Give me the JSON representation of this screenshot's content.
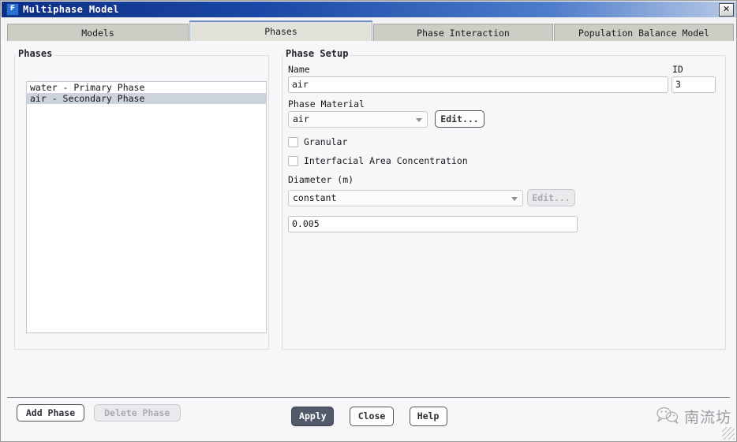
{
  "window": {
    "title": "Multiphase Model",
    "icon": "fluent-app-icon",
    "icon_letter": "F",
    "close_label": "✕"
  },
  "tabs": [
    {
      "label": "Models",
      "selected": false
    },
    {
      "label": "Phases",
      "selected": true
    },
    {
      "label": "Phase Interaction",
      "selected": false
    },
    {
      "label": "Population Balance Model",
      "selected": false
    }
  ],
  "phases_panel": {
    "title": "Phases",
    "items": [
      {
        "label": "water - Primary Phase",
        "selected": false
      },
      {
        "label": "air - Secondary Phase",
        "selected": true
      }
    ],
    "add_label": "Add Phase",
    "delete_label": "Delete Phase",
    "delete_enabled": false
  },
  "phase_setup": {
    "title": "Phase Setup",
    "name_label": "Name",
    "name_value": "air",
    "id_label": "ID",
    "id_value": "3",
    "material_label": "Phase Material",
    "material_value": "air",
    "material_edit_label": "Edit...",
    "granular_label": "Granular",
    "granular_checked": false,
    "interfacial_label": "Interfacial Area Concentration",
    "interfacial_checked": false,
    "diameter_label": "Diameter (m)",
    "diameter_method": "constant",
    "diameter_edit_label": "Edit...",
    "diameter_edit_enabled": false,
    "diameter_value": "0.005"
  },
  "footer": {
    "apply_label": "Apply",
    "close_label": "Close",
    "help_label": "Help"
  },
  "watermark": {
    "text": "南流坊",
    "icon": "wechat-icon"
  },
  "colors": {
    "titlebar_start": "#0c2f84",
    "tab_selected": "#e2e1da",
    "tab_normal": "#cdccc5",
    "list_selection": "#ccd3dc",
    "primary_button": "#52596b",
    "panel_bg": "#f7f7f9"
  }
}
